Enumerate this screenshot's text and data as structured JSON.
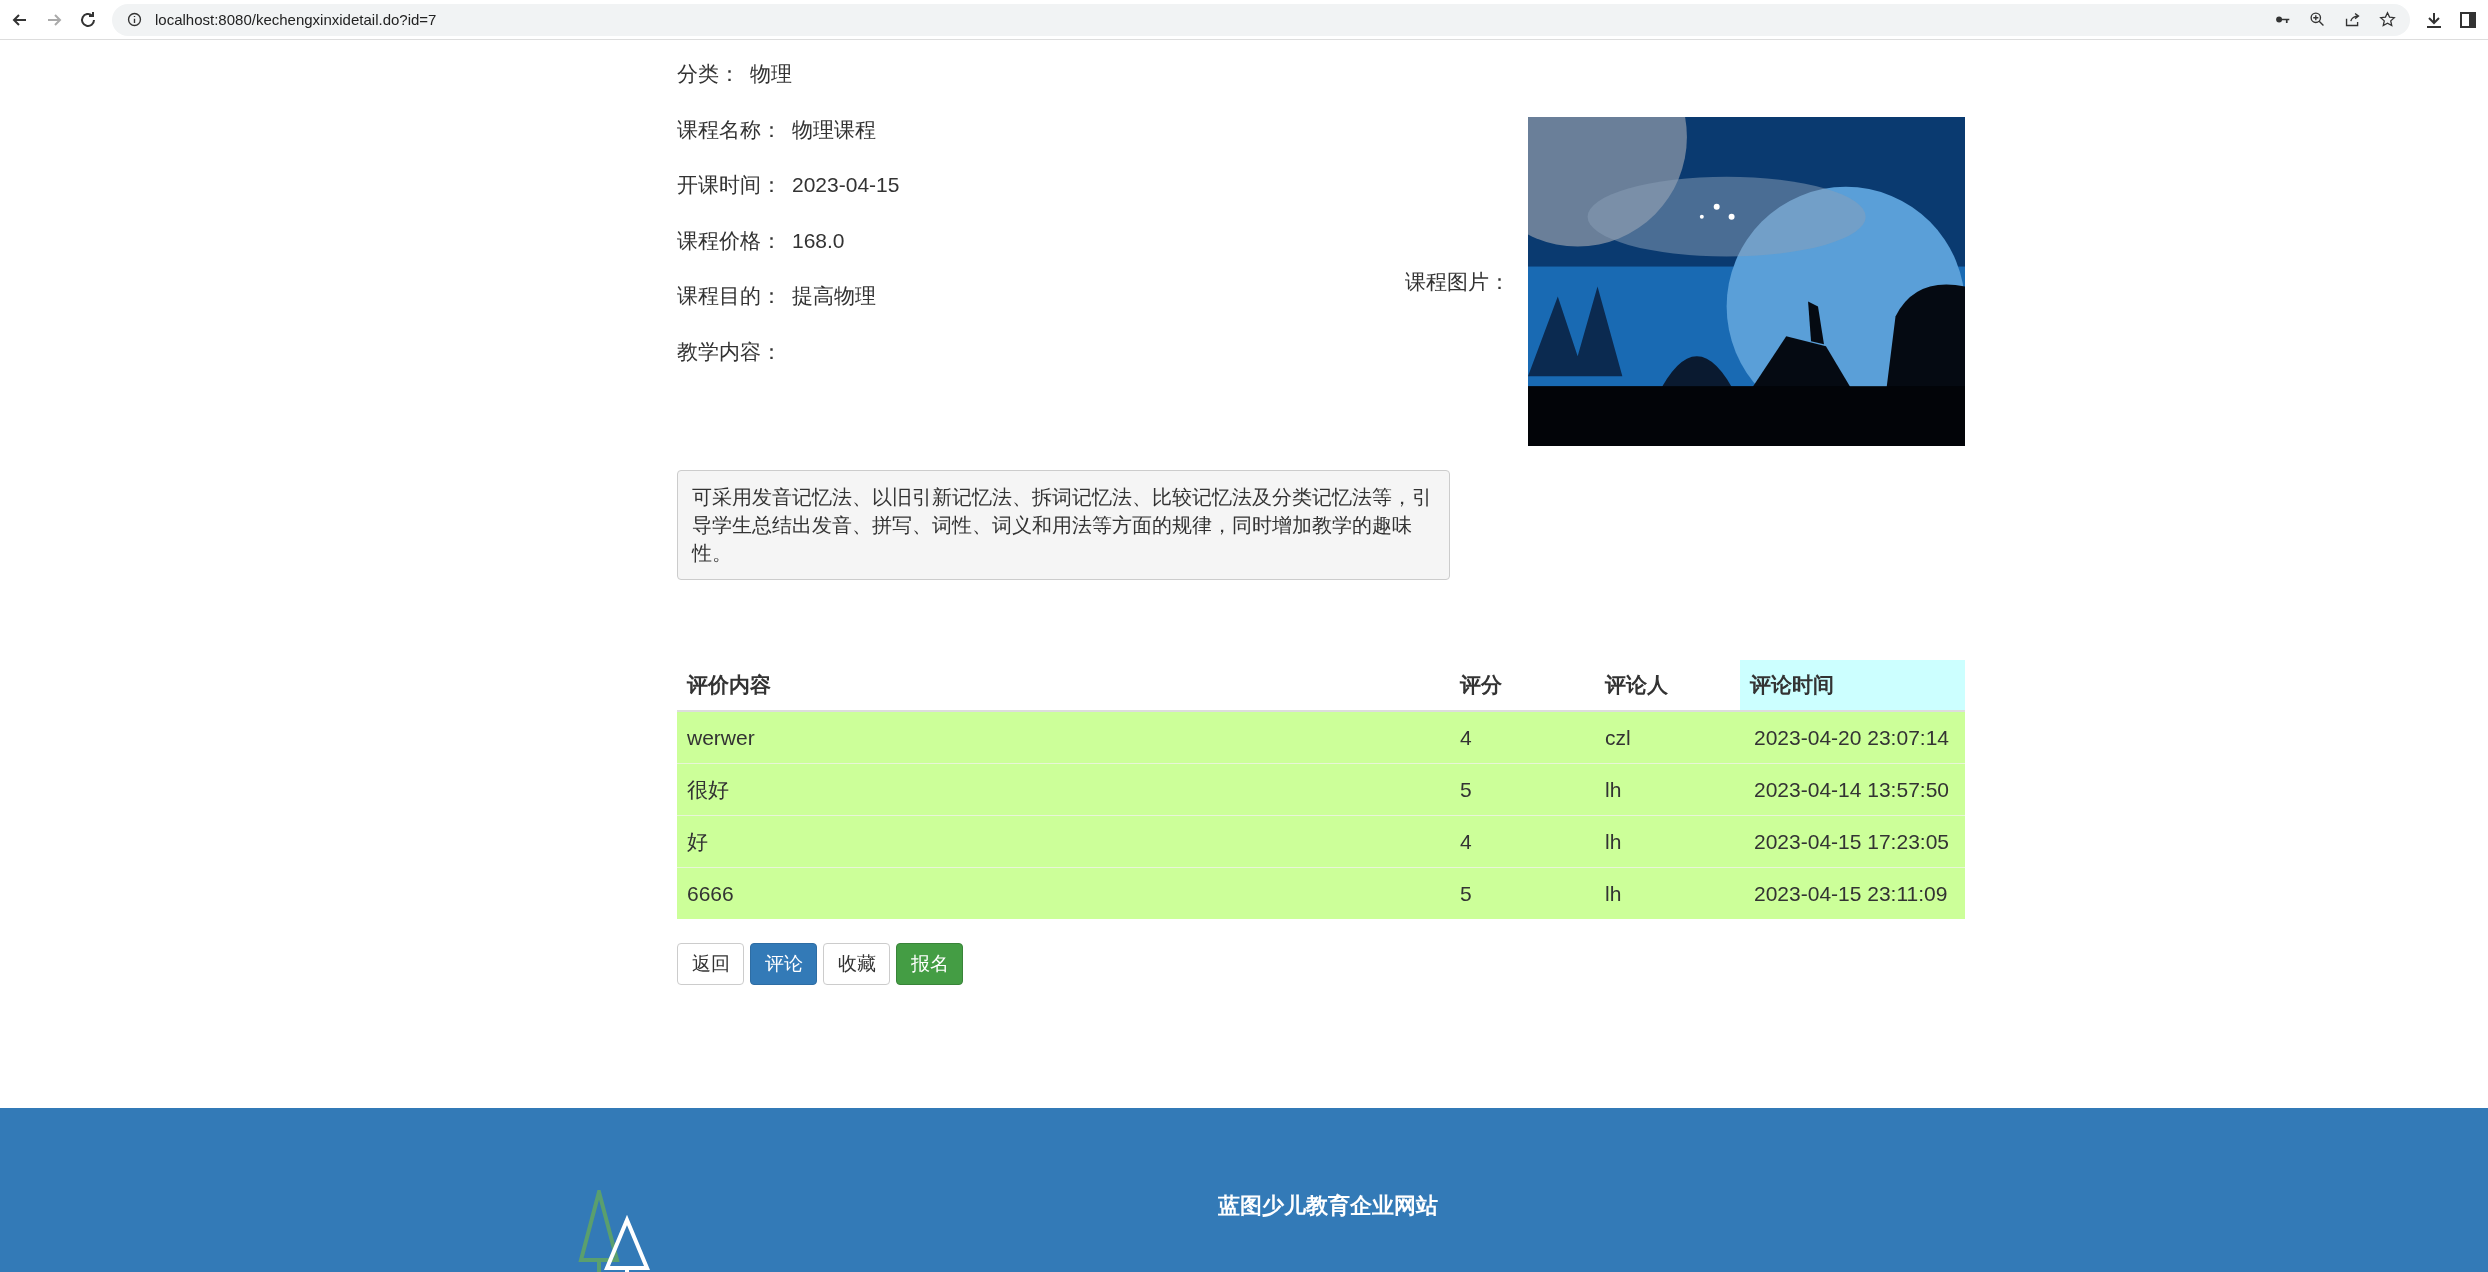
{
  "browser": {
    "url": "localhost:8080/kechengxinxidetail.do?id=7"
  },
  "details": [
    {
      "label": "分类：",
      "value": "物理"
    },
    {
      "label": "课程名称：",
      "value": "物理课程"
    },
    {
      "label": "开课时间：",
      "value": "2023-04-15"
    },
    {
      "label": "课程价格：",
      "value": "168.0"
    },
    {
      "label": "课程目的：",
      "value": "提高物理"
    },
    {
      "label": "教学内容："
    }
  ],
  "image_label": "课程图片：",
  "content": "可采用发音记忆法、以旧引新记忆法、拆词记忆法、比较记忆法及分类记忆法等，引导学生总结出发音、拼写、词性、词义和用法等方面的规律，同时增加教学的趣味性。",
  "table": {
    "columns": [
      {
        "label": "评价内容",
        "highlighted": false
      },
      {
        "label": "评分",
        "highlighted": false
      },
      {
        "label": "评论人",
        "highlighted": false
      },
      {
        "label": "评论时间",
        "highlighted": true
      }
    ],
    "rows": [
      [
        "werwer",
        "4",
        "czl",
        "2023-04-20 23:07:14"
      ],
      [
        "很好",
        "5",
        "lh",
        "2023-04-14 13:57:50"
      ],
      [
        "好",
        "4",
        "lh",
        "2023-04-15 17:23:05"
      ],
      [
        "6666",
        "5",
        "lh",
        "2023-04-15 23:11:09"
      ]
    ]
  },
  "buttons": [
    {
      "label": "返回",
      "kind": "default"
    },
    {
      "label": "评论",
      "kind": "primary"
    },
    {
      "label": "收藏",
      "kind": "default"
    },
    {
      "label": "报名",
      "kind": "success"
    }
  ],
  "footer": {
    "title": "蓝图少儿教育企业网站"
  }
}
